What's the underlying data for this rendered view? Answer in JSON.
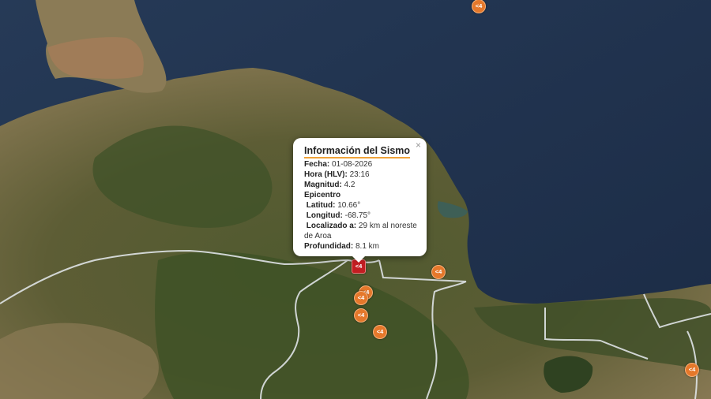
{
  "popup": {
    "close": "×",
    "title": "Información del Sismo",
    "fecha_label": "Fecha:",
    "fecha": "01-08-2026",
    "hora_label": "Hora (HLV):",
    "hora": "23:16",
    "magnitud_label": "Magnitud:",
    "magnitud": "4.2",
    "epicentro_label": "Epicentro",
    "latitud_label": "Latitud:",
    "latitud": "10.66°",
    "longitud_label": "Longitud:",
    "longitud": "-68.75°",
    "localizado_label": "Localizado a:",
    "localizado": "29 km al noreste de Aroa",
    "profundidad_label": "Profundidad:",
    "profundidad": "8.1 km"
  },
  "markers": {
    "selected_label": "<4",
    "label": "<4",
    "color": "#e5782b",
    "selected_color": "#c31d22"
  }
}
